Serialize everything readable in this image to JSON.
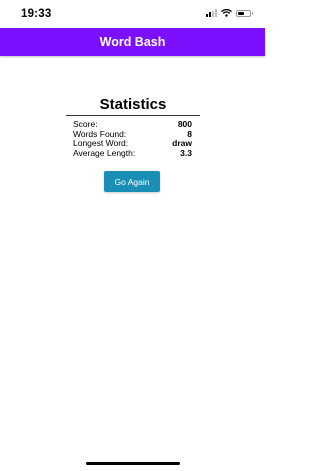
{
  "status_bar": {
    "time": "19:33",
    "icons": [
      "signal-icon",
      "wifi-icon",
      "battery-icon"
    ]
  },
  "app_bar": {
    "title": "Word Bash",
    "color": "#7d0fff"
  },
  "statistics": {
    "title": "Statistics",
    "rows": [
      {
        "label": "Score:",
        "value": "800"
      },
      {
        "label": "Words Found:",
        "value": "8"
      },
      {
        "label": "Longest Word:",
        "value": "draw"
      },
      {
        "label": "Average Length:",
        "value": "3.3"
      }
    ]
  },
  "actions": {
    "go_again_label": "Go Again",
    "button_color": "#1a8fb6"
  }
}
